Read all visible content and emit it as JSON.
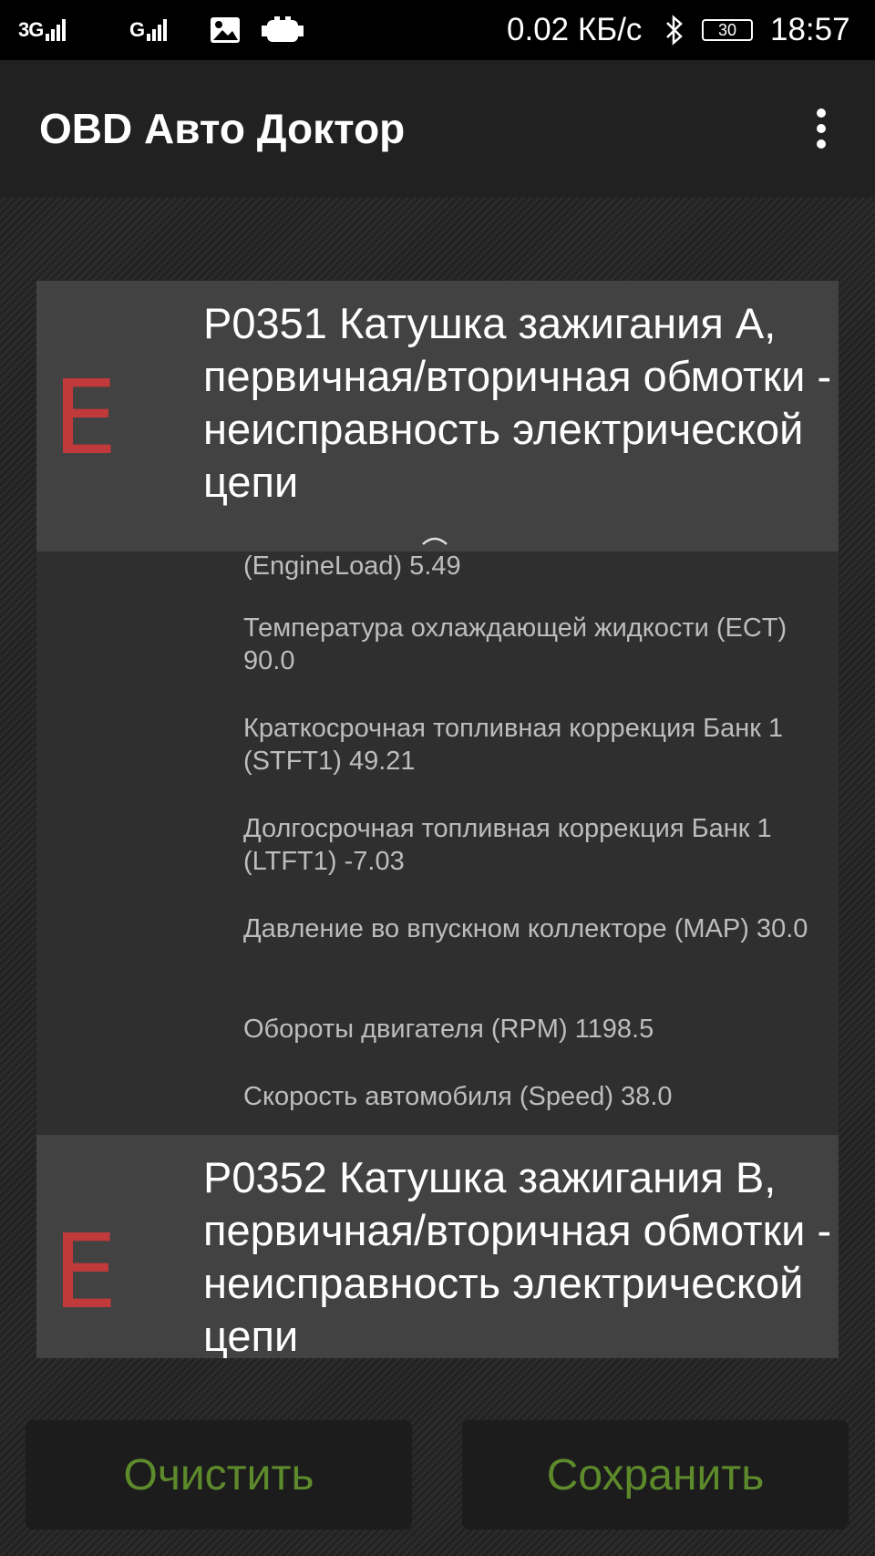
{
  "status_bar": {
    "sim1_network": "3G",
    "sim2_network": "G",
    "network_speed": "0.02 КБ/с",
    "battery_level": "30",
    "time": "18:57",
    "icons": [
      "signal-icon",
      "image-notification-icon",
      "obd-connector-icon",
      "bluetooth-icon",
      "battery-icon"
    ]
  },
  "app_bar": {
    "title": "OBD Авто Доктор",
    "menu_icon": "overflow-menu-icon"
  },
  "dtc_list": [
    {
      "status_letter": "E",
      "code": "P0351",
      "description": "Катушка зажигания A, первичная/вторичная обмотки - неисправность электрической цепи",
      "status_color": "#c0393b"
    },
    {
      "status_letter": "E",
      "code": "P0352",
      "description": "Катушка зажигания B, первичная/вторичная обмотки - неисправность электрической цепи",
      "status_color": "#c0393b"
    }
  ],
  "freeze_frame": [
    "(EngineLoad) 5.49",
    "Температура охлаждающей жидкости (ECT) 90.0",
    "Краткосрочная топливная коррекция Банк 1 (STFT1) 49.21",
    "Долгосрочная топливная коррекция Банк 1 (LTFT1) -7.03",
    "Давление во впускном коллекторе (MAP) 30.0",
    "Обороты двигателя (RPM) 1198.5",
    "Скорость автомобиля (Speed) 38.0"
  ],
  "buttons": {
    "clear_label": "Очистить",
    "save_label": "Сохранить",
    "accent_color": "#5d8a2b"
  }
}
